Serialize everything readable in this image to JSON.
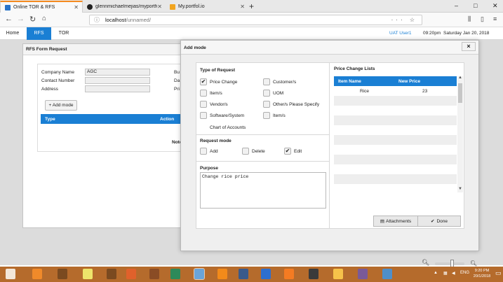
{
  "browser": {
    "tabs": [
      {
        "title": "Online TOR & RFS",
        "icon_color": "#2a74c9",
        "active": true
      },
      {
        "title": "glennmichaelmejias/myportfo",
        "icon_color": "#222222",
        "active": false
      },
      {
        "title": "My.portfol.io",
        "icon_color": "#f2a51f",
        "active": false
      }
    ],
    "url_host": "localhost",
    "url_path": "/unnamed/",
    "url_icons": "··· ☆",
    "window_controls": [
      "–",
      "□",
      "✕"
    ]
  },
  "app": {
    "nav": [
      {
        "label": "Home",
        "active": false
      },
      {
        "label": "RFS",
        "active": true
      },
      {
        "label": "TOR",
        "active": false
      }
    ],
    "user": "UAT User1",
    "time": "09:20pm",
    "date": "Saturday  Jan 20, 2018"
  },
  "rfs_form": {
    "title": "RFS Form Request",
    "fields": [
      {
        "label": "Company Name",
        "value": "AGC"
      },
      {
        "label": "Contact Number",
        "value": ""
      },
      {
        "label": "Address",
        "value": ""
      }
    ],
    "side_labels": [
      "Bu",
      "Da",
      "Pri"
    ],
    "add_mode_label": "Add mode",
    "table_headers": [
      "Type",
      "Action"
    ],
    "note_label": "Note"
  },
  "modal": {
    "title": "Add mode",
    "close_label": "×",
    "type_of_request_label": "Type of Request",
    "request_types_left": [
      {
        "label": "Price Change",
        "checked": true
      },
      {
        "label": "Item/s",
        "checked": false
      },
      {
        "label": "Vendor/s",
        "checked": false
      },
      {
        "label": "Software/System",
        "checked": false
      },
      {
        "label": "Chart of Accounts",
        "checked": false
      }
    ],
    "request_types_right": [
      {
        "label": "Customer/s",
        "checked": false
      },
      {
        "label": "UOM",
        "checked": false
      },
      {
        "label": "Other/s Please Specify",
        "checked": false
      },
      {
        "label": "Item/s",
        "checked": false
      }
    ],
    "request_mode_label": "Request mode",
    "request_modes": [
      {
        "label": "Add",
        "checked": false
      },
      {
        "label": "Delete",
        "checked": false
      },
      {
        "label": "Edit",
        "checked": true
      }
    ],
    "purpose_label": "Purpose",
    "purpose_value": "Change rice price",
    "price_change_title": "Price Change Lists",
    "price_change_headers": [
      "Item Name",
      "New Price"
    ],
    "price_change_rows": [
      {
        "item": "Rice",
        "price": "23"
      }
    ],
    "attachments_label": "Attachments",
    "done_label": "Done"
  },
  "zoom": {
    "minus": "−",
    "plus": "+"
  },
  "taskbar": {
    "icons": [
      {
        "name": "start",
        "color": "#f3e7d8"
      },
      {
        "name": "app1",
        "color": "#f08a2a"
      },
      {
        "name": "app2",
        "color": "#7a4a20"
      },
      {
        "name": "app3",
        "color": "#ede46b"
      },
      {
        "name": "app4",
        "color": "#7a4a20"
      },
      {
        "name": "app5",
        "color": "#e0612b"
      },
      {
        "name": "app6",
        "color": "#8a4c25"
      },
      {
        "name": "app7",
        "color": "#2d8a5a"
      },
      {
        "name": "app8",
        "color": "#6aa4d8"
      },
      {
        "name": "app9",
        "color": "#f28a1a"
      },
      {
        "name": "app10",
        "color": "#3a5a8a"
      },
      {
        "name": "app11",
        "color": "#2e6fcf"
      },
      {
        "name": "app12",
        "color": "#f47b22"
      },
      {
        "name": "app13",
        "color": "#3a3a3a"
      },
      {
        "name": "app14",
        "color": "#f6c24a"
      },
      {
        "name": "app15",
        "color": "#7a5a98"
      },
      {
        "name": "app16",
        "color": "#4f8fc9"
      }
    ],
    "tray": "ENG",
    "clock_time": "9:20 PM",
    "clock_date": "20/1/2018"
  }
}
